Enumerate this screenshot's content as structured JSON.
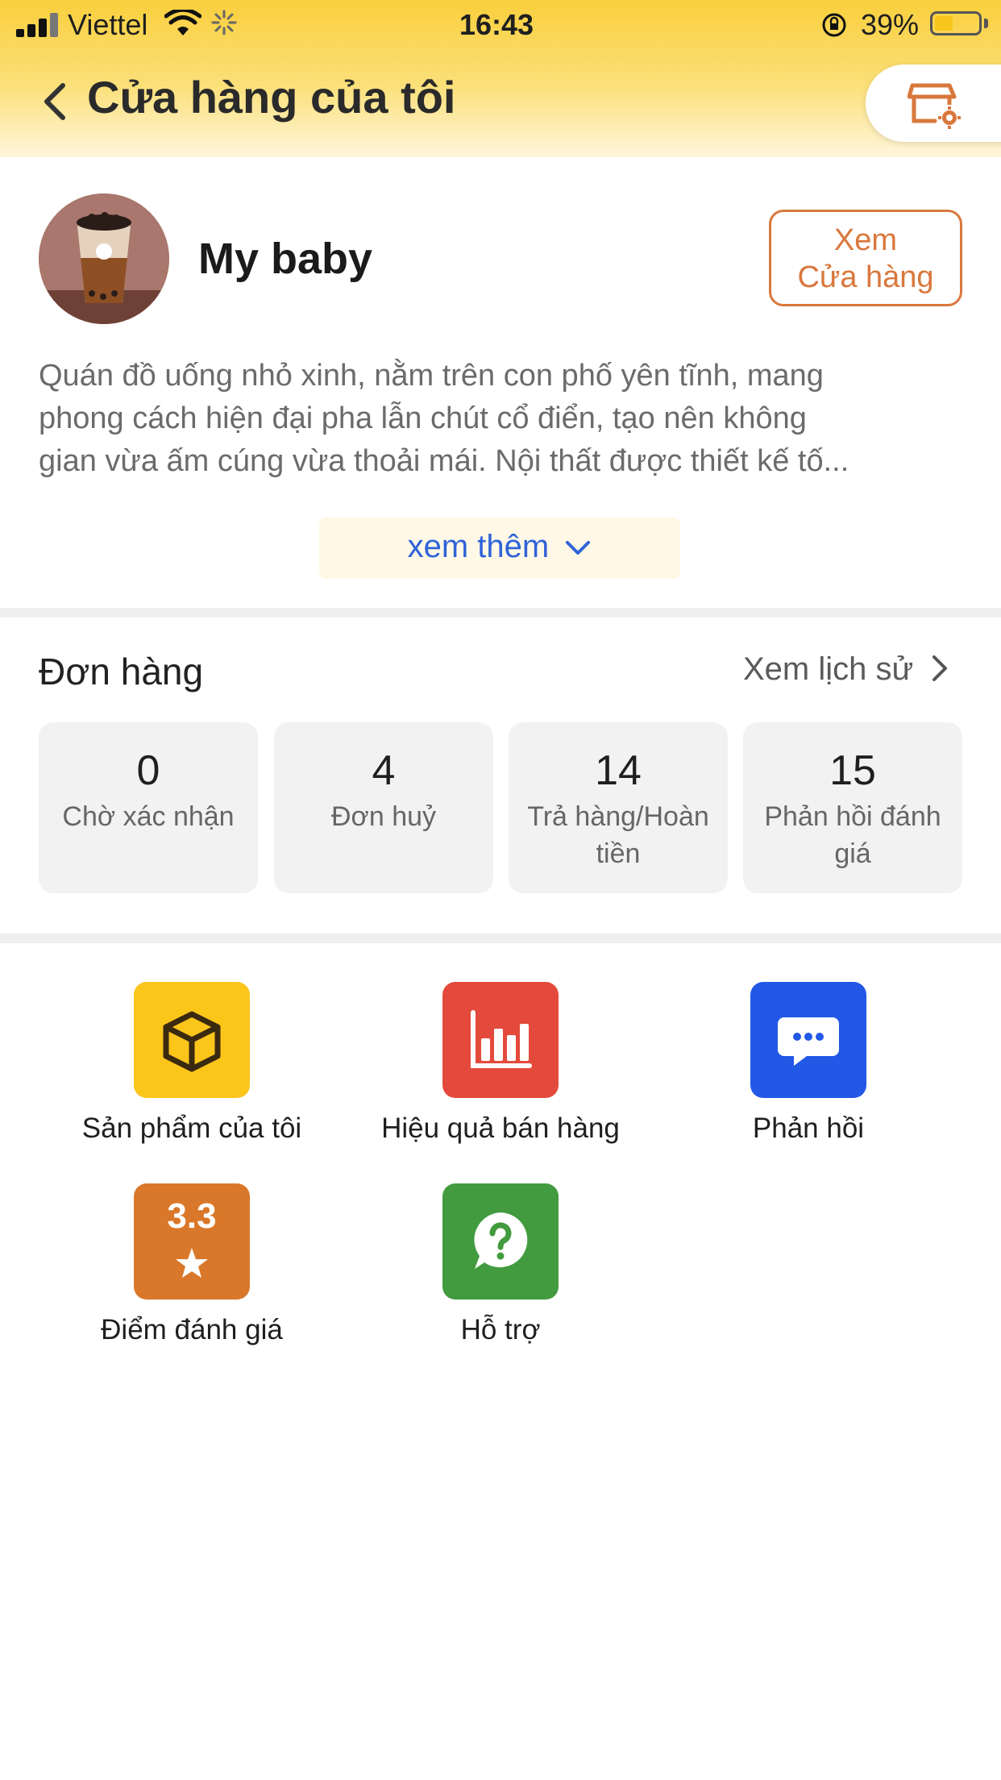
{
  "status_bar": {
    "carrier": "Viettel",
    "time": "16:43",
    "battery_percent_text": "39%",
    "battery_level": 0.39
  },
  "header": {
    "title": "Cửa hàng của tôi"
  },
  "shop": {
    "name": "My baby",
    "view_button": [
      "Xem",
      "Cửa hàng"
    ],
    "description_lines": [
      "Quán đồ uống nhỏ xinh, nằm trên con phố yên tĩnh, mang",
      "phong cách hiện đại pha lẫn chút cổ điển, tạo nên không",
      "gian vừa ấm cúng vừa thoải mái. Nội thất được thiết kế tố..."
    ],
    "see_more": "xem thêm"
  },
  "orders": {
    "title": "Đơn hàng",
    "history_link": "Xem lịch sử",
    "stats": [
      {
        "value": "0",
        "label": "Chờ xác nhận"
      },
      {
        "value": "4",
        "label": "Đơn huỷ"
      },
      {
        "value": "14",
        "label": "Trả hàng/Hoàn tiền"
      },
      {
        "value": "15",
        "label": "Phản hồi đánh giá"
      }
    ]
  },
  "features": [
    {
      "label": "Sản phẩm của tôi",
      "icon": "box-icon",
      "color": "#fbc51a"
    },
    {
      "label": "Hiệu quả bán hàng",
      "icon": "bar-chart-icon",
      "color": "#e44a3c"
    },
    {
      "label": "Phản hồi",
      "icon": "chat-bubble-icon",
      "color": "#2258e6"
    },
    {
      "label": "Điểm đánh giá",
      "icon": "star-icon",
      "color": "#d9782a",
      "rating": "3.3"
    },
    {
      "label": "Hỗ trợ",
      "icon": "help-icon",
      "color": "#429b3e"
    }
  ],
  "colors": {
    "accent_orange": "#d9783d",
    "link_blue": "#2f63d8",
    "header_yellow": "#f9cf3c"
  }
}
